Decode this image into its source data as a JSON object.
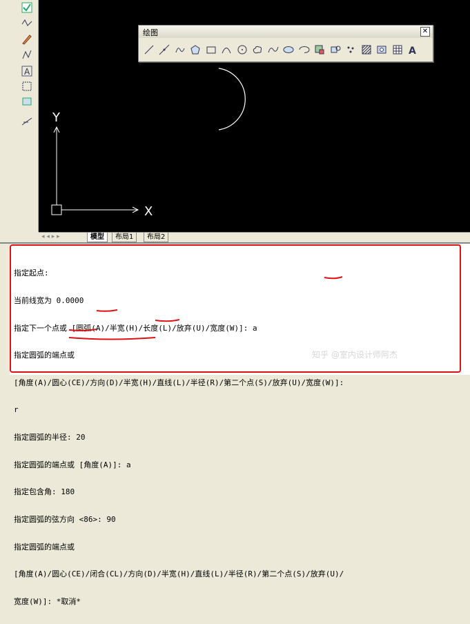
{
  "palette": {
    "title": "绘图",
    "close_label": "✕",
    "tools": [
      "line-tool",
      "construction-line-tool",
      "polyline-tool",
      "polygon-tool",
      "rectangle-tool",
      "arc-tool",
      "circle-tool",
      "revision-cloud-tool",
      "spline-tool",
      "ellipse-tool",
      "ellipse-arc-tool",
      "insert-block-tool",
      "make-block-tool",
      "point-tool",
      "hatch-tool",
      "region-tool",
      "table-tool",
      "multiline-text-tool"
    ]
  },
  "left_toolbar": {
    "tools": [
      "check-icon",
      "construction-line-icon",
      "pencil-icon",
      "polyline-icon",
      "text-a-icon",
      "region-icon",
      "block-icon",
      "spline-icon"
    ]
  },
  "ucs": {
    "x_label": "X",
    "y_label": "Y"
  },
  "tabs": {
    "nav": "◂ ◂ ▸ ▸",
    "model": "模型",
    "layout1": "布局1",
    "layout2": "布局2"
  },
  "command": {
    "lines": [
      "指定起点:",
      "当前线宽为 0.0000",
      "指定下一个点或 [圆弧(A)/半宽(H)/长度(L)/放弃(U)/宽度(W)]: a",
      "指定圆弧的端点或",
      "[角度(A)/圆心(CE)/方向(D)/半宽(H)/直线(L)/半径(R)/第二个点(S)/放弃(U)/宽度(W)]:",
      "r",
      "指定圆弧的半径: 20",
      "指定圆弧的端点或 [角度(A)]: a",
      "指定包含角: 180",
      "指定圆弧的弦方向 <86>: 90",
      "指定圆弧的端点或",
      "[角度(A)/圆心(CE)/闭合(CL)/方向(D)/半宽(H)/直线(L)/半径(R)/第二个点(S)/放弃(U)/",
      "宽度(W)]: *取消*"
    ]
  },
  "watermark": "知乎 @室内设计师阿杰",
  "colors": {
    "canvas": "#000000",
    "annotation": "#dd1111",
    "cad_white": "#ffffff"
  }
}
